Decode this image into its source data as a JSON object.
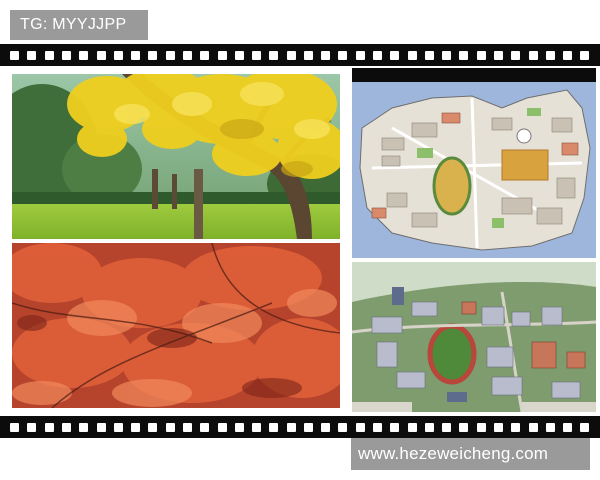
{
  "watermark_top": "TG: MYYJJPP",
  "watermark_bottom": "www.hezeweicheng.com",
  "photos": [
    {
      "name": "ginkgo-tree-photo",
      "description_color": "#e8c21a"
    },
    {
      "name": "red-maple-photo",
      "description_color": "#d84a2a"
    },
    {
      "name": "campus-map-photo",
      "description_color": "#8fa8d0"
    },
    {
      "name": "campus-model-photo",
      "description_color": "#7e9a6a"
    }
  ],
  "colors": {
    "film": "#0c0c0c",
    "watermark_bg": "#9a9a9a",
    "watermark_text": "#ffffff"
  }
}
